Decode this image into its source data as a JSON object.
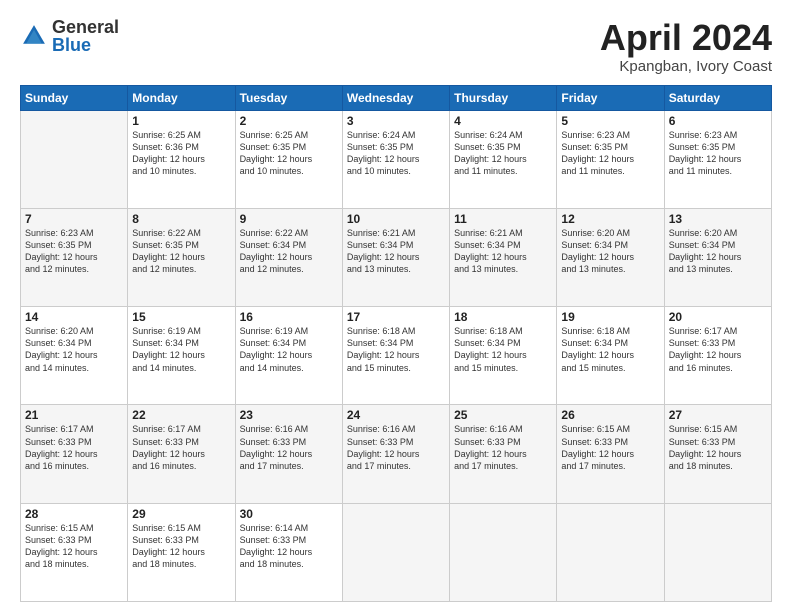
{
  "logo": {
    "general": "General",
    "blue": "Blue"
  },
  "title": "April 2024",
  "location": "Kpangban, Ivory Coast",
  "days_of_week": [
    "Sunday",
    "Monday",
    "Tuesday",
    "Wednesday",
    "Thursday",
    "Friday",
    "Saturday"
  ],
  "weeks": [
    [
      {
        "day": "",
        "sunrise": "",
        "sunset": "",
        "daylight": ""
      },
      {
        "day": "1",
        "sunrise": "Sunrise: 6:25 AM",
        "sunset": "Sunset: 6:36 PM",
        "daylight": "Daylight: 12 hours and 10 minutes."
      },
      {
        "day": "2",
        "sunrise": "Sunrise: 6:25 AM",
        "sunset": "Sunset: 6:35 PM",
        "daylight": "Daylight: 12 hours and 10 minutes."
      },
      {
        "day": "3",
        "sunrise": "Sunrise: 6:24 AM",
        "sunset": "Sunset: 6:35 PM",
        "daylight": "Daylight: 12 hours and 10 minutes."
      },
      {
        "day": "4",
        "sunrise": "Sunrise: 6:24 AM",
        "sunset": "Sunset: 6:35 PM",
        "daylight": "Daylight: 12 hours and 11 minutes."
      },
      {
        "day": "5",
        "sunrise": "Sunrise: 6:23 AM",
        "sunset": "Sunset: 6:35 PM",
        "daylight": "Daylight: 12 hours and 11 minutes."
      },
      {
        "day": "6",
        "sunrise": "Sunrise: 6:23 AM",
        "sunset": "Sunset: 6:35 PM",
        "daylight": "Daylight: 12 hours and 11 minutes."
      }
    ],
    [
      {
        "day": "7",
        "sunrise": "Sunrise: 6:23 AM",
        "sunset": "Sunset: 6:35 PM",
        "daylight": "Daylight: 12 hours and 12 minutes."
      },
      {
        "day": "8",
        "sunrise": "Sunrise: 6:22 AM",
        "sunset": "Sunset: 6:35 PM",
        "daylight": "Daylight: 12 hours and 12 minutes."
      },
      {
        "day": "9",
        "sunrise": "Sunrise: 6:22 AM",
        "sunset": "Sunset: 6:34 PM",
        "daylight": "Daylight: 12 hours and 12 minutes."
      },
      {
        "day": "10",
        "sunrise": "Sunrise: 6:21 AM",
        "sunset": "Sunset: 6:34 PM",
        "daylight": "Daylight: 12 hours and 13 minutes."
      },
      {
        "day": "11",
        "sunrise": "Sunrise: 6:21 AM",
        "sunset": "Sunset: 6:34 PM",
        "daylight": "Daylight: 12 hours and 13 minutes."
      },
      {
        "day": "12",
        "sunrise": "Sunrise: 6:20 AM",
        "sunset": "Sunset: 6:34 PM",
        "daylight": "Daylight: 12 hours and 13 minutes."
      },
      {
        "day": "13",
        "sunrise": "Sunrise: 6:20 AM",
        "sunset": "Sunset: 6:34 PM",
        "daylight": "Daylight: 12 hours and 13 minutes."
      }
    ],
    [
      {
        "day": "14",
        "sunrise": "Sunrise: 6:20 AM",
        "sunset": "Sunset: 6:34 PM",
        "daylight": "Daylight: 12 hours and 14 minutes."
      },
      {
        "day": "15",
        "sunrise": "Sunrise: 6:19 AM",
        "sunset": "Sunset: 6:34 PM",
        "daylight": "Daylight: 12 hours and 14 minutes."
      },
      {
        "day": "16",
        "sunrise": "Sunrise: 6:19 AM",
        "sunset": "Sunset: 6:34 PM",
        "daylight": "Daylight: 12 hours and 14 minutes."
      },
      {
        "day": "17",
        "sunrise": "Sunrise: 6:18 AM",
        "sunset": "Sunset: 6:34 PM",
        "daylight": "Daylight: 12 hours and 15 minutes."
      },
      {
        "day": "18",
        "sunrise": "Sunrise: 6:18 AM",
        "sunset": "Sunset: 6:34 PM",
        "daylight": "Daylight: 12 hours and 15 minutes."
      },
      {
        "day": "19",
        "sunrise": "Sunrise: 6:18 AM",
        "sunset": "Sunset: 6:34 PM",
        "daylight": "Daylight: 12 hours and 15 minutes."
      },
      {
        "day": "20",
        "sunrise": "Sunrise: 6:17 AM",
        "sunset": "Sunset: 6:33 PM",
        "daylight": "Daylight: 12 hours and 16 minutes."
      }
    ],
    [
      {
        "day": "21",
        "sunrise": "Sunrise: 6:17 AM",
        "sunset": "Sunset: 6:33 PM",
        "daylight": "Daylight: 12 hours and 16 minutes."
      },
      {
        "day": "22",
        "sunrise": "Sunrise: 6:17 AM",
        "sunset": "Sunset: 6:33 PM",
        "daylight": "Daylight: 12 hours and 16 minutes."
      },
      {
        "day": "23",
        "sunrise": "Sunrise: 6:16 AM",
        "sunset": "Sunset: 6:33 PM",
        "daylight": "Daylight: 12 hours and 17 minutes."
      },
      {
        "day": "24",
        "sunrise": "Sunrise: 6:16 AM",
        "sunset": "Sunset: 6:33 PM",
        "daylight": "Daylight: 12 hours and 17 minutes."
      },
      {
        "day": "25",
        "sunrise": "Sunrise: 6:16 AM",
        "sunset": "Sunset: 6:33 PM",
        "daylight": "Daylight: 12 hours and 17 minutes."
      },
      {
        "day": "26",
        "sunrise": "Sunrise: 6:15 AM",
        "sunset": "Sunset: 6:33 PM",
        "daylight": "Daylight: 12 hours and 17 minutes."
      },
      {
        "day": "27",
        "sunrise": "Sunrise: 6:15 AM",
        "sunset": "Sunset: 6:33 PM",
        "daylight": "Daylight: 12 hours and 18 minutes."
      }
    ],
    [
      {
        "day": "28",
        "sunrise": "Sunrise: 6:15 AM",
        "sunset": "Sunset: 6:33 PM",
        "daylight": "Daylight: 12 hours and 18 minutes."
      },
      {
        "day": "29",
        "sunrise": "Sunrise: 6:15 AM",
        "sunset": "Sunset: 6:33 PM",
        "daylight": "Daylight: 12 hours and 18 minutes."
      },
      {
        "day": "30",
        "sunrise": "Sunrise: 6:14 AM",
        "sunset": "Sunset: 6:33 PM",
        "daylight": "Daylight: 12 hours and 18 minutes."
      },
      {
        "day": "",
        "sunrise": "",
        "sunset": "",
        "daylight": ""
      },
      {
        "day": "",
        "sunrise": "",
        "sunset": "",
        "daylight": ""
      },
      {
        "day": "",
        "sunrise": "",
        "sunset": "",
        "daylight": ""
      },
      {
        "day": "",
        "sunrise": "",
        "sunset": "",
        "daylight": ""
      }
    ]
  ]
}
